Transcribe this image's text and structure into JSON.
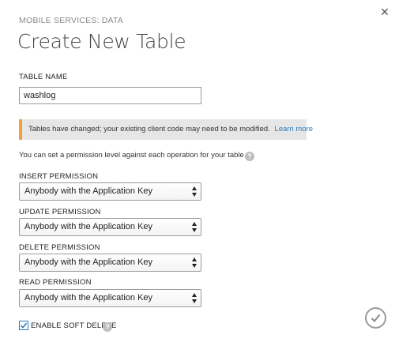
{
  "breadcrumb": "MOBILE SERVICES: DATA",
  "title": "Create New Table",
  "table_name": {
    "label": "TABLE NAME",
    "value": "washlog"
  },
  "alert": {
    "message": "Tables have changed; your existing client code may need to be modified.",
    "link": "Learn more",
    "accent_color": "#f0a33a"
  },
  "info": {
    "text": "You can set a permission level against each operation for your table.",
    "help_icon": "?"
  },
  "permissions": [
    {
      "label": "INSERT PERMISSION",
      "value": "Anybody with the Application Key"
    },
    {
      "label": "UPDATE PERMISSION",
      "value": "Anybody with the Application Key"
    },
    {
      "label": "DELETE PERMISSION",
      "value": "Anybody with the Application Key"
    },
    {
      "label": "READ PERMISSION",
      "value": "Anybody with the Application Key"
    }
  ],
  "soft_delete": {
    "label": "ENABLE SOFT DELETE",
    "checked": true,
    "help_icon": "?"
  },
  "icons": {
    "close": "close-icon",
    "confirm": "checkmark-icon",
    "help": "help-icon",
    "select_arrows": "updown-arrows-icon"
  },
  "close_glyph": "✕",
  "colors": {
    "link": "#2a7ab9",
    "checkbox_border": "#2a7ab9"
  }
}
